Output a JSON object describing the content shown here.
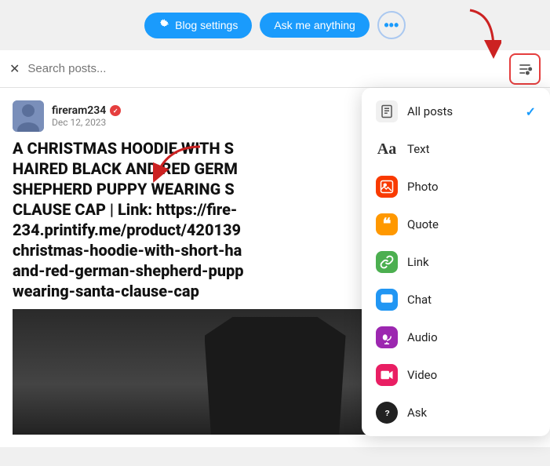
{
  "topbar": {
    "blog_settings_label": "Blog settings",
    "ask_label": "Ask me anything",
    "more_dots": "···"
  },
  "searchbar": {
    "placeholder": "Search posts...",
    "close_label": "×"
  },
  "post": {
    "username": "fireram234",
    "date": "Dec 12, 2023",
    "title": "A CHRISTMAS HOODIE WITH S HAIRED BLACK AND RED GERM SHEPHERD PUPPY WEARING S CLAUSE CAP | Link: https://fire- 234.printify.me/product/420139 christmas-hoodie-with-short-ha and-red-german-shepherd-pupp wearing-santa-clause-cap"
  },
  "dropdown": {
    "items": [
      {
        "id": "allposts",
        "label": "All posts",
        "icon": "document-icon",
        "checked": true
      },
      {
        "id": "text",
        "label": "Text",
        "icon": "text-icon",
        "checked": false
      },
      {
        "id": "photo",
        "label": "Photo",
        "icon": "photo-icon",
        "checked": false
      },
      {
        "id": "quote",
        "label": "Quote",
        "icon": "quote-icon",
        "checked": false
      },
      {
        "id": "link",
        "label": "Link",
        "icon": "link-icon",
        "checked": false
      },
      {
        "id": "chat",
        "label": "Chat",
        "icon": "chat-icon",
        "checked": false
      },
      {
        "id": "audio",
        "label": "Audio",
        "icon": "audio-icon",
        "checked": false
      },
      {
        "id": "video",
        "label": "Video",
        "icon": "video-icon",
        "checked": false
      },
      {
        "id": "ask",
        "label": "Ask",
        "icon": "ask-icon",
        "checked": false
      }
    ]
  }
}
